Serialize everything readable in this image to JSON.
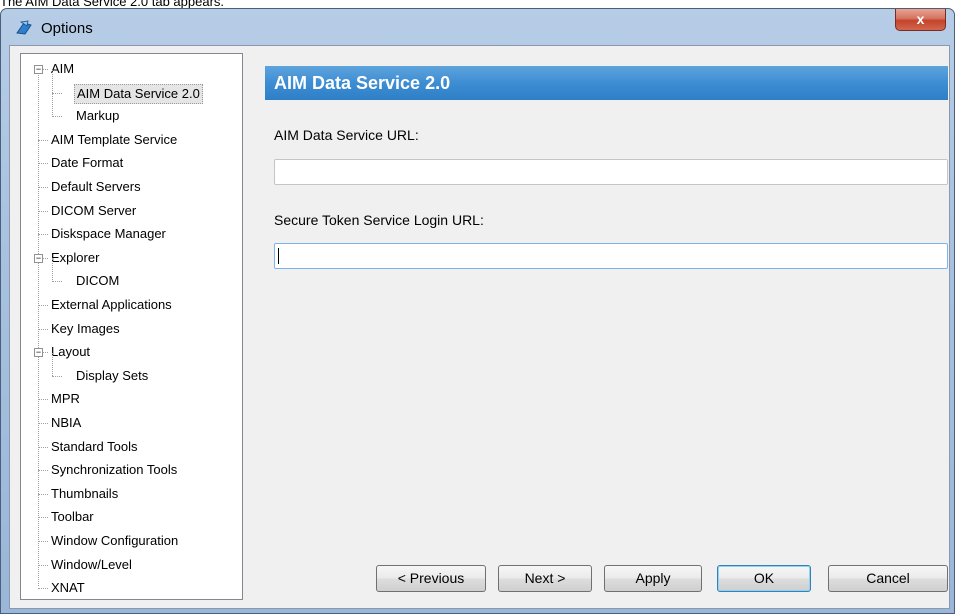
{
  "caption": "The AIM Data Service 2.0 tab appears.",
  "window": {
    "title": "Options",
    "close_label": "x",
    "app_icon": "options-icon"
  },
  "tree": {
    "items": [
      {
        "label": "AIM",
        "level": 0,
        "expander": "⊟"
      },
      {
        "label": "AIM Data Service 2.0",
        "level": 1,
        "selected": true
      },
      {
        "label": "Markup",
        "level": 1
      },
      {
        "label": "AIM Template Service",
        "level": 0
      },
      {
        "label": "Date Format",
        "level": 0
      },
      {
        "label": "Default Servers",
        "level": 0
      },
      {
        "label": "DICOM Server",
        "level": 0
      },
      {
        "label": "Diskspace Manager",
        "level": 0
      },
      {
        "label": "Explorer",
        "level": 0,
        "expander": "⊟"
      },
      {
        "label": "DICOM",
        "level": 1
      },
      {
        "label": "External Applications",
        "level": 0
      },
      {
        "label": "Key Images",
        "level": 0
      },
      {
        "label": "Layout",
        "level": 0,
        "expander": "⊟"
      },
      {
        "label": "Display Sets",
        "level": 1
      },
      {
        "label": "MPR",
        "level": 0
      },
      {
        "label": "NBIA",
        "level": 0
      },
      {
        "label": "Standard Tools",
        "level": 0
      },
      {
        "label": "Synchronization Tools",
        "level": 0
      },
      {
        "label": "Thumbnails",
        "level": 0
      },
      {
        "label": "Toolbar",
        "level": 0
      },
      {
        "label": "Window Configuration",
        "level": 0
      },
      {
        "label": "Window/Level",
        "level": 0
      },
      {
        "label": "XNAT",
        "level": 0
      }
    ]
  },
  "panel": {
    "header": "AIM Data Service 2.0",
    "url_label": "AIM Data Service URL:",
    "url_value": "",
    "sts_label": "Secure Token Service Login URL:",
    "sts_value": ""
  },
  "buttons": {
    "previous": "< Previous",
    "next": "Next >",
    "apply": "Apply",
    "ok": "OK",
    "cancel": "Cancel"
  },
  "colors": {
    "header_blue": "#3d8dd3",
    "window_frame": "#a8c1e0",
    "close_red": "#c5432a"
  }
}
